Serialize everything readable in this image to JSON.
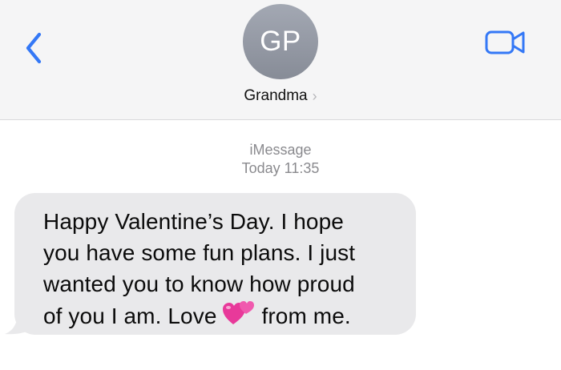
{
  "header": {
    "back_icon": "chevron-left-icon",
    "avatar_initials": "GP",
    "contact_name": "Grandma",
    "contact_chevron": "›",
    "video_icon": "video-camera-icon",
    "accent_color": "#3478f6"
  },
  "meta": {
    "service": "iMessage",
    "timestamp": "Today 11:35"
  },
  "message": {
    "line1": "Happy Valentine’s Day.  I hope",
    "line2": "you have some fun plans.  I just",
    "line3": "wanted you to know how proud",
    "line4_before": "of you I am. Love",
    "emoji": "two-hearts-emoji",
    "line4_after": "from me.",
    "bubble_color": "#e9e9eb"
  }
}
